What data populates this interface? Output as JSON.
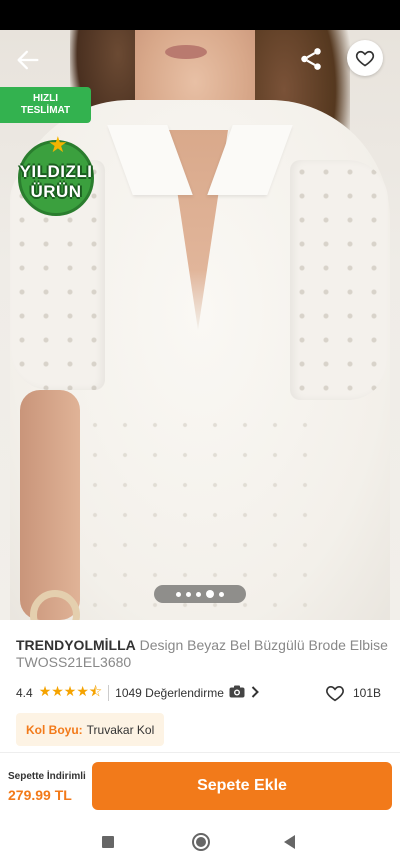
{
  "icons": {
    "back": "arrow-left-icon",
    "share": "share-icon",
    "favorite": "heart-icon",
    "camera": "camera-icon",
    "chevron": "chevron-right-icon"
  },
  "badges": {
    "fast_delivery_line1": "HIZLI",
    "fast_delivery_line2": "TESLİMAT",
    "star_product_line1": "YILDIZLI",
    "star_product_line2": "ÜRÜN"
  },
  "gallery": {
    "image_count": 5,
    "active_index": 3
  },
  "product": {
    "brand": "TRENDYOLMİLLA",
    "name": "Design Beyaz Bel Büzgülü Brode Elbise TWOSS21EL3680",
    "rating": "4.4",
    "rating_value": 4.4,
    "stars": "★★★★⯪",
    "reviews": "1049 Değerlendirme",
    "favorites": "101B"
  },
  "variant": {
    "key": "Kol Boyu:",
    "value": "Truvakar Kol"
  },
  "cart": {
    "discount_label": "Sepette İndirimli",
    "price": "279.99 TL",
    "add_label": "Sepete Ekle"
  },
  "colors": {
    "brand_orange": "#f27a1a",
    "fast_green": "#33b24f",
    "star_yellow": "#f5a300"
  }
}
